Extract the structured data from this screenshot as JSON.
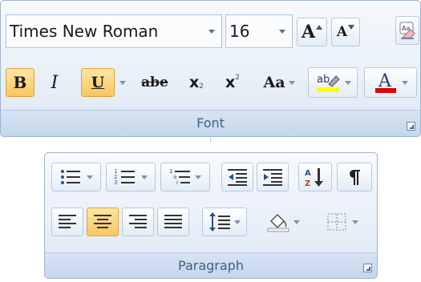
{
  "font_group": {
    "caption": "Font",
    "font_name": "Times New Roman",
    "font_size": "16",
    "grow_font_label": "A",
    "shrink_font_label": "A",
    "bold_label": "B",
    "italic_label": "I",
    "underline_label": "U",
    "strikethrough_label": "abe",
    "subscript_label": "x",
    "superscript_label": "x",
    "change_case_label": "Aa",
    "highlight_label": "ab",
    "font_color_label": "A",
    "highlight_color": "#ffff00",
    "font_color": "#e00000",
    "active_color": "#f8c65e"
  },
  "paragraph_group": {
    "caption": "Paragraph"
  }
}
